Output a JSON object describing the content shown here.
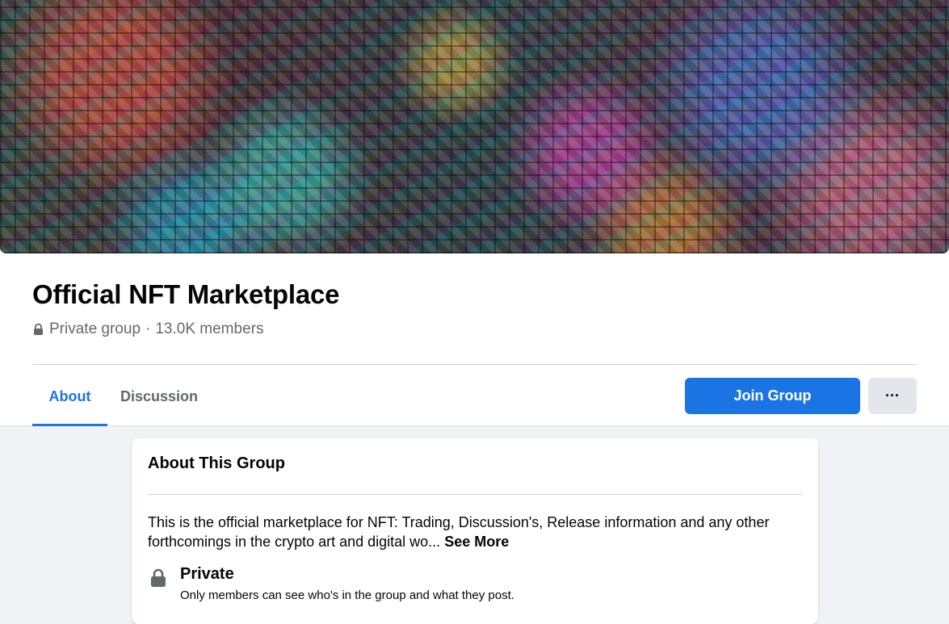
{
  "group": {
    "name": "Official NFT Marketplace",
    "privacy": "Private group",
    "separator": "·",
    "members": "13.0K members"
  },
  "tabs": [
    {
      "label": "About",
      "active": true
    },
    {
      "label": "Discussion",
      "active": false
    }
  ],
  "actions": {
    "join_label": "Join Group",
    "more_label": "···"
  },
  "about": {
    "title": "About This Group",
    "description": "This is the official marketplace for NFT: Trading, Discussion's, Release information and any other forthcomings in the crypto art and digital wo... ",
    "see_more": "See More",
    "privacy_title": "Private",
    "privacy_desc": "Only members can see who's in the group and what they post."
  },
  "icons": {
    "lock_small": "lock-icon",
    "lock_large": "lock-icon",
    "more": "more-dots-icon"
  },
  "colors": {
    "accent": "#1b74e4",
    "muted_text": "#65676b",
    "page_background": "#f0f2f5",
    "secondary_button": "#e4e6eb"
  }
}
